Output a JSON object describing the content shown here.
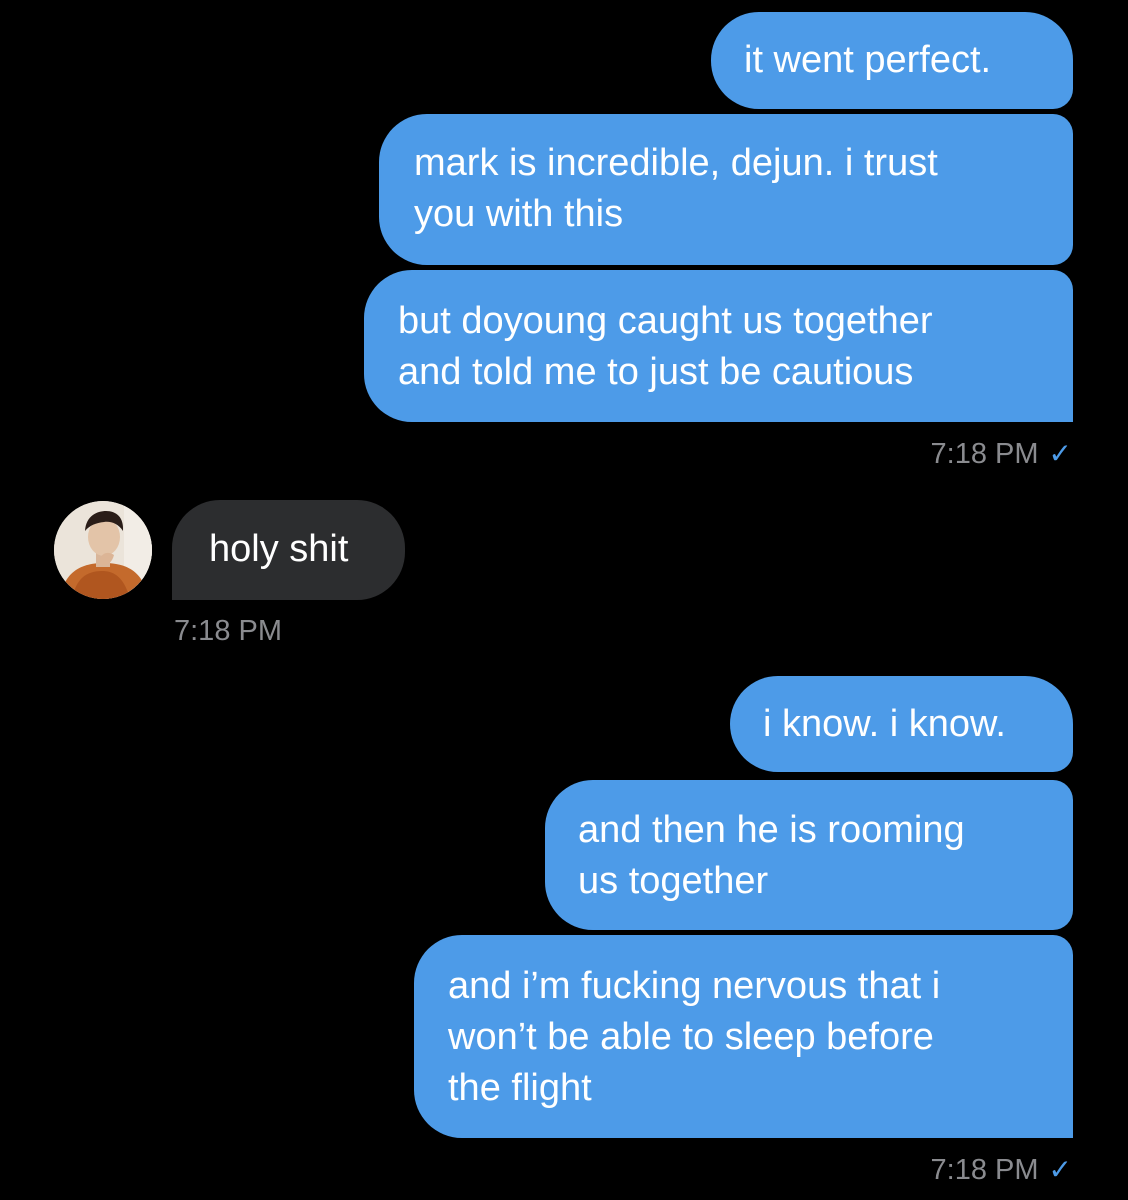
{
  "thread": {
    "group1": {
      "messages": [
        {
          "lines": [
            "it went perfect."
          ]
        },
        {
          "lines": [
            "mark is incredible, dejun. i trust",
            "you with this"
          ]
        },
        {
          "lines": [
            "but doyoung caught us together",
            "and told me to just be cautious"
          ]
        }
      ],
      "time": "7:18 PM",
      "status": "✓"
    },
    "incoming": {
      "text": "holy shit",
      "time": "7:18 PM"
    },
    "group2": {
      "messages": [
        {
          "lines": [
            "i know. i know."
          ]
        },
        {
          "lines": [
            "and then he is rooming",
            "us together"
          ]
        },
        {
          "lines": [
            "and i’m fucking nervous that i",
            "won’t be able to sleep before",
            "the flight"
          ]
        }
      ],
      "time": "7:18 PM",
      "status": "✓"
    }
  },
  "colors": {
    "background": "#000000",
    "outgoing_bubble": "#4d9be8",
    "incoming_bubble": "#2c2d2f",
    "timestamp": "#8a8b8f"
  }
}
